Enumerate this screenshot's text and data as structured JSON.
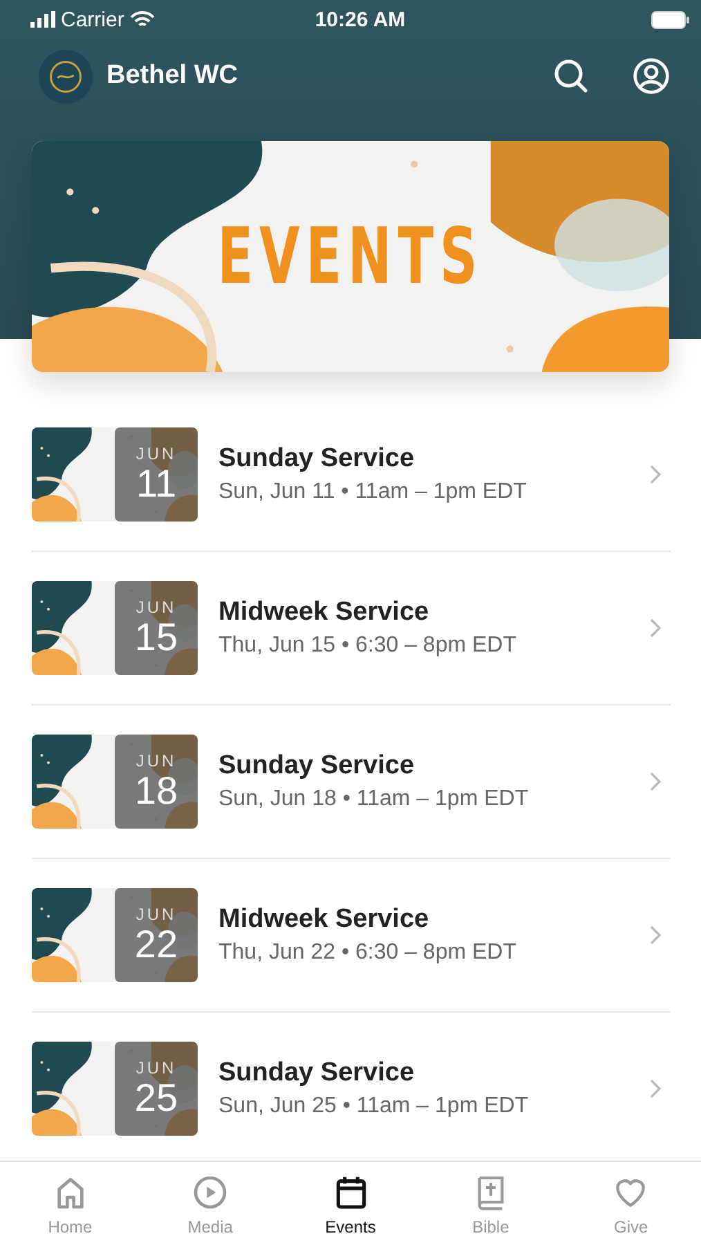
{
  "status_bar": {
    "carrier": "Carrier",
    "time": "10:26 AM"
  },
  "header": {
    "title": "Bethel WC"
  },
  "banner": {
    "kind": "picture",
    "title": "EVENTS"
  },
  "events": [
    {
      "title": "Sunday Service",
      "details": "Sun, Jun 11 • 11am – 1pm EDT",
      "month": "JUN",
      "day": "11"
    },
    {
      "title": "Midweek Service",
      "details": "Thu, Jun 15 • 6:30 – 8pm EDT",
      "month": "JUN",
      "day": "15"
    },
    {
      "title": "Sunday Service",
      "details": "Sun, Jun 18 • 11am – 1pm EDT",
      "month": "JUN",
      "day": "18"
    },
    {
      "title": "Midweek Service",
      "details": "Thu, Jun 22 • 6:30 – 8pm EDT",
      "month": "JUN",
      "day": "22"
    },
    {
      "title": "Sunday Service",
      "details": "Sun, Jun 25 • 11am – 1pm EDT",
      "month": "JUN",
      "day": "25"
    }
  ],
  "tabs": [
    {
      "label": "Home",
      "kind": "home",
      "selected": false
    },
    {
      "label": "Media",
      "kind": "media",
      "selected": false
    },
    {
      "label": "Events",
      "kind": "events",
      "selected": true
    },
    {
      "label": "Bible",
      "kind": "bible",
      "selected": false
    },
    {
      "label": "Give",
      "kind": "give",
      "selected": false
    }
  ]
}
